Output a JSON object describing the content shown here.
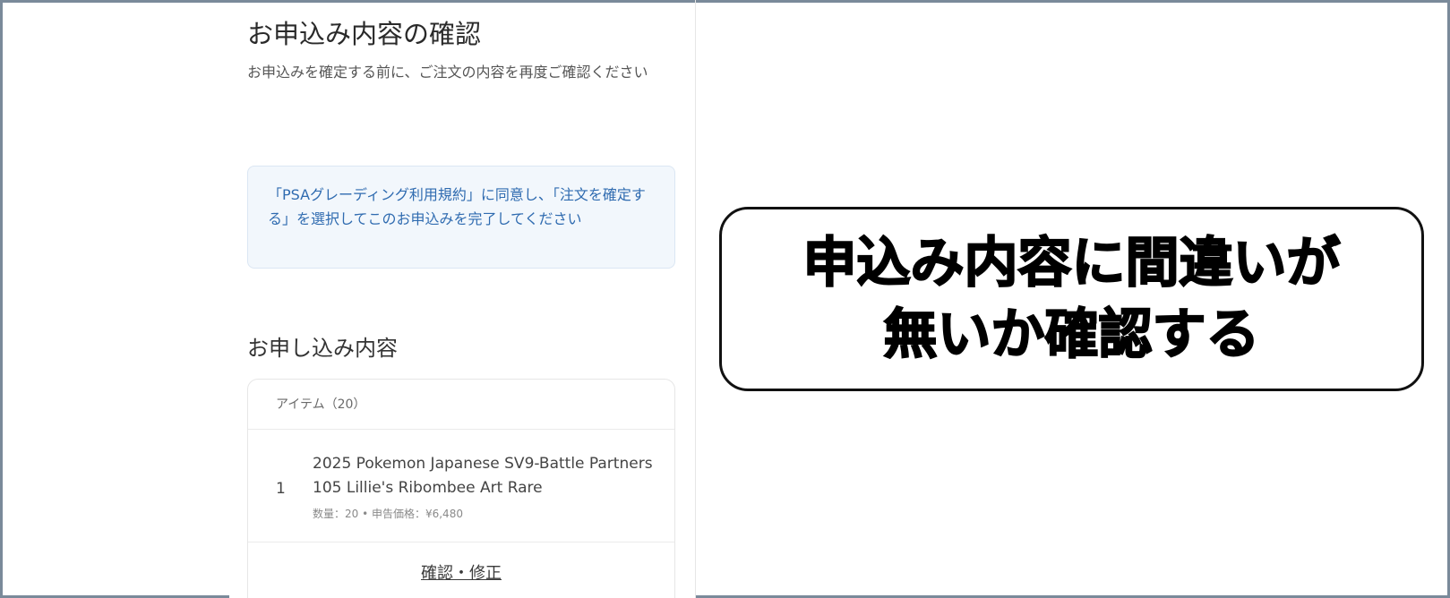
{
  "page": {
    "title": "お申込み内容の確認",
    "subtitle": "お申込みを確定する前に、ご注文の内容を再度ご確認ください"
  },
  "notice": {
    "text": "「PSAグレーディング利用規約」に同意し、「注文を確定する」を選択してこのお申込みを完了してください"
  },
  "order": {
    "section_title": "お申し込み内容",
    "items_header": "アイテム（20）",
    "items": [
      {
        "index": "1",
        "name": "2025 Pokemon Japanese SV9-Battle Partners 105 Lillie's Ribombee Art Rare",
        "meta": "数量：20 • 申告価格：¥6,480"
      }
    ],
    "edit_label": "確認・修正"
  },
  "callout": {
    "line1": "申込み内容に間違いが",
    "line2": "無いか確認する"
  },
  "colors": {
    "frame_border": "#7a8a9a",
    "notice_bg": "#f2f7fc",
    "notice_text": "#2f6bb0",
    "callout_border": "#111111"
  }
}
